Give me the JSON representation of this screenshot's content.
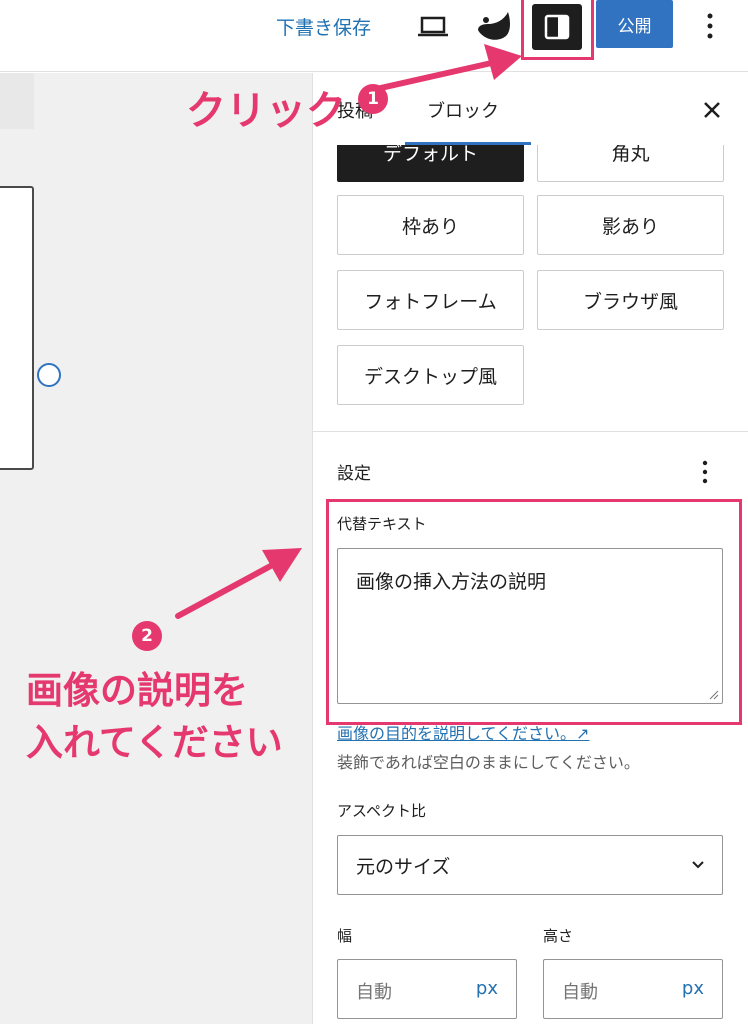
{
  "topbar": {
    "draft_label": "下書き保存",
    "publish_label": "公開",
    "preview_icon": "laptop-icon",
    "logo_icon": "brand-logo-icon",
    "sidebar_icon": "sidebar-toggle-icon",
    "more_icon": "vertical-dots-icon"
  },
  "sidebar": {
    "tabs": [
      {
        "label": "投稿"
      },
      {
        "label": "ブロック",
        "active": true
      }
    ],
    "close_icon": "close-icon",
    "styles": [
      {
        "label": "デフォルト",
        "active": true
      },
      {
        "label": "角丸"
      },
      {
        "label": "枠あり"
      },
      {
        "label": "影あり"
      },
      {
        "label": "フォトフレーム"
      },
      {
        "label": "ブラウザ風"
      },
      {
        "label": "デスクトップ風"
      }
    ],
    "settings": {
      "title": "設定",
      "alt_label": "代替テキスト",
      "alt_value": "画像の挿入方法の説明",
      "alt_link": "画像の目的を説明してください。↗",
      "alt_help": "装飾であれば空白のままにしてください。",
      "aspect_label": "アスペクト比",
      "aspect_value": "元のサイズ",
      "width_label": "幅",
      "height_label": "高さ",
      "width_placeholder": "自動",
      "height_placeholder": "自動",
      "unit": "px"
    }
  },
  "annotations": {
    "step1_text": "クリック",
    "step1_badge": "1",
    "step2_badge": "2",
    "step2_line1": "画像の説明を",
    "step2_line2": "入れてください",
    "accent_color": "#e5386e"
  },
  "colors": {
    "primary": "#3173c1",
    "link": "#2271b1",
    "dark": "#1e1e1e"
  }
}
